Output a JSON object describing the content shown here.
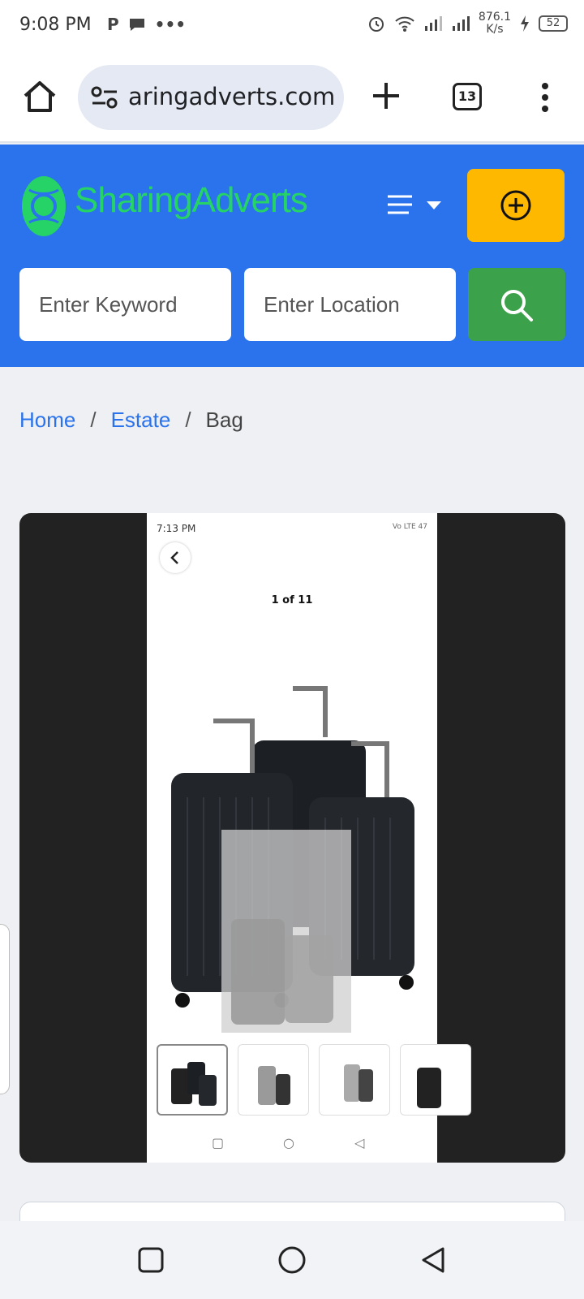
{
  "status_bar": {
    "time": "9:08 PM",
    "left_icons": [
      "P",
      "•••"
    ],
    "speed": "876.1",
    "speed_unit": "K/s",
    "battery": "52"
  },
  "browser": {
    "url": "aringadverts.com",
    "tab_count": "13"
  },
  "site": {
    "logo_word1": "Sharing",
    "logo_word2": "Adverts",
    "logo_color": "#25d366",
    "header_color": "#2a73ec",
    "post_ad_color": "#ffb800",
    "search_color": "#3ba14a",
    "keyword_placeholder": "Enter Keyword",
    "location_placeholder": "Enter Location"
  },
  "breadcrumb": {
    "items": [
      "Home",
      "Estate"
    ],
    "separator": "/",
    "current": "Bag"
  },
  "gallery": {
    "inner_time": "7:13 PM",
    "inner_status": "Vo LTE 47",
    "counter": "1 of 11"
  }
}
